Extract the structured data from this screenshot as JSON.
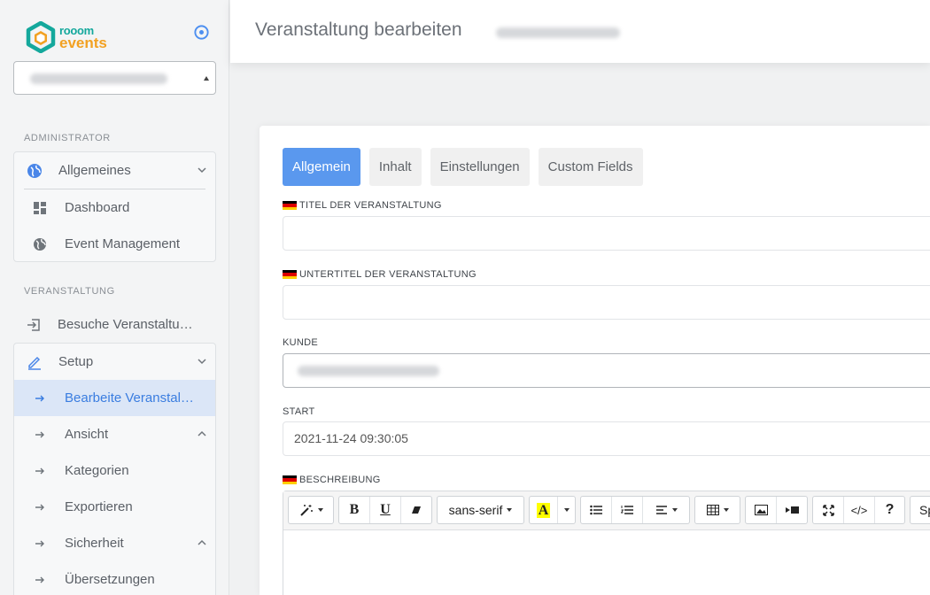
{
  "brand": {
    "room": "rooom",
    "events": "events",
    "accent_teal": "#14a89c",
    "accent_orange": "#f2a122"
  },
  "sidebar": {
    "target_icon": "target-icon",
    "sections": {
      "admin": "ADMINISTRATOR",
      "event": "VERANSTALTUNG"
    },
    "admin_card": {
      "group_label": "Allgemeines",
      "items": [
        {
          "label": "Dashboard",
          "icon": "dashboard-icon"
        },
        {
          "label": "Event Management",
          "icon": "globe-icon"
        }
      ]
    },
    "visits_label": "Besuche Veranstaltu…",
    "setup_card": {
      "group_label": "Setup",
      "items": [
        {
          "label": "Bearbeite Veranstal…",
          "active": true
        },
        {
          "label": "Ansicht",
          "expanded": true
        },
        {
          "label": "Kategorien"
        },
        {
          "label": "Exportieren"
        },
        {
          "label": "Sicherheit",
          "expanded": true
        },
        {
          "label": "Übersetzungen"
        }
      ]
    }
  },
  "header": {
    "title": "Veranstaltung bearbeiten"
  },
  "tabs": [
    "Allgemein",
    "Inhalt",
    "Einstellungen",
    "Custom Fields"
  ],
  "active_tab": "Allgemein",
  "form": {
    "title_label": "TITEL DER VERANSTALTUNG",
    "subtitle_label": "UNTERTITEL DER VERANSTALTUNG",
    "customer_label": "KUNDE",
    "start_label": "START",
    "start_value": "2021-11-24 09:30:05",
    "description_label": "BESCHREIBUNG"
  },
  "editor_toolbar": {
    "bold": "B",
    "underline": "U",
    "font_name": "sans-serif",
    "color_letter": "A",
    "code": "</>",
    "help": "?",
    "size_partial": "Sp"
  },
  "colors": {
    "primary_tab": "#5a98ee",
    "active_menu_bg": "#dbe6f7",
    "active_menu_text": "#3a7de0"
  }
}
